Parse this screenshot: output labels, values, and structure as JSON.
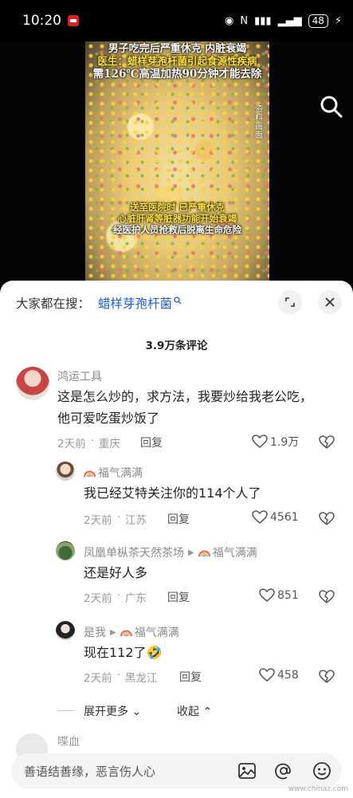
{
  "status": {
    "time": "10:20",
    "battery": "48"
  },
  "video": {
    "caption_top1": "男子吃完后严重休克 内脏衰竭",
    "caption_top2": "医生：蜡样芽孢杆菌引起食源性疾病",
    "caption_top3": "需126℃高温加热90分钟才能去除",
    "caption_side": "资料画面",
    "caption_bottom1": "送至医院时 已严重休克",
    "caption_bottom2": "心脏肝肾等脏器功能开始衰竭",
    "caption_bottom3": "经医护人员抢救后脱离生命危险"
  },
  "sheet": {
    "search_prefix": "大家都在搜：",
    "search_term": "蜡样芽孢杆菌",
    "comment_count": "3.9万条评论"
  },
  "comments": [
    {
      "user": "鸿运工具",
      "text_line1": "这是怎么炒的，求方法，我要炒给我老公吃，",
      "text_line2": "他可爱吃蛋炒饭了",
      "time": "2天前",
      "location": "重庆",
      "reply": "回复",
      "likes": "1.9万"
    },
    {
      "user": "福气满满",
      "text": "我已经艾特关注你的114个人了",
      "time": "2天前",
      "location": "江苏",
      "reply": "回复",
      "likes": "4561"
    },
    {
      "user": "凤凰单枞茶天然茶场",
      "reply_to": "福气满满",
      "text": "还是好人多",
      "time": "2天前",
      "location": "广东",
      "reply": "回复",
      "likes": "851"
    },
    {
      "user": "是我",
      "reply_to": "福气满满",
      "text": "现在112了🤣",
      "time": "2天前",
      "location": "黑龙江",
      "reply": "回复",
      "likes": "458"
    }
  ],
  "thread": {
    "expand": "展开更多",
    "collapse": "收起"
  },
  "next_comment_user": "喋血",
  "input": {
    "placeholder": "善语结善缘，恶言伤人心"
  },
  "watermark": "www.chinaz.com"
}
